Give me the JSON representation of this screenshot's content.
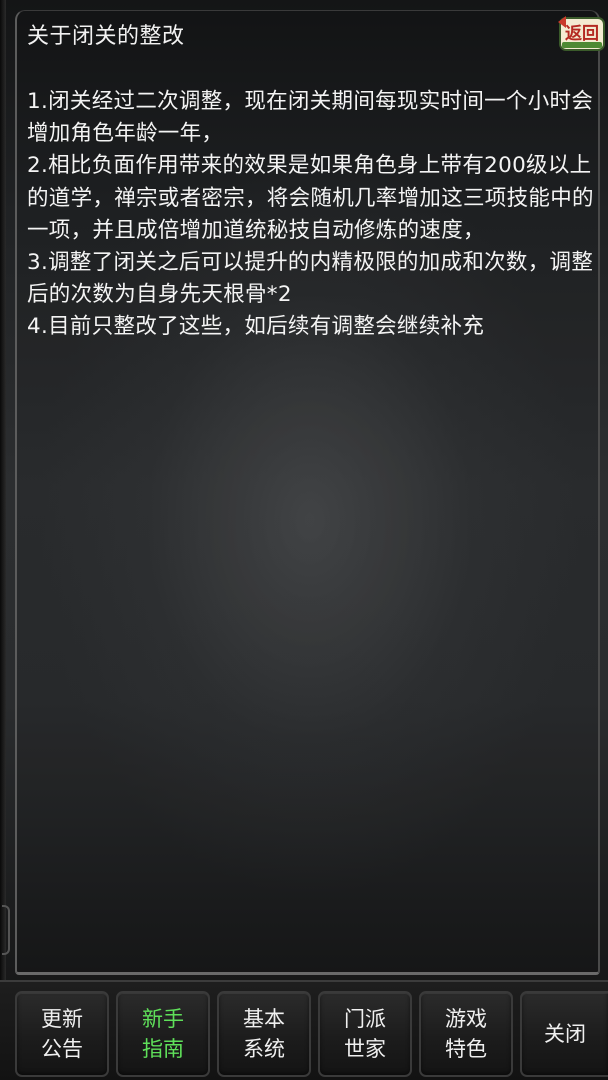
{
  "header": {
    "title": "关于闭关的整改",
    "back_icon": "return-badge-icon",
    "back_icon_text": "返回"
  },
  "notice": {
    "lines": [
      "1.闭关经过二次调整，现在闭关期间每现实时间一个小时会增加角色年龄一年，",
      "2.相比负面作用带来的效果是如果角色身上带有200级以上的道学，禅宗或者密宗，将会随机几率增加这三项技能中的一项，并且成倍增加道统秘技自动修炼的速度，",
      "3.调整了闭关之后可以提升的内精极限的加成和次数，调整后的次数为自身先天根骨*2",
      "4.目前只整改了这些，如后续有调整会继续补充"
    ]
  },
  "bottom_nav": {
    "items": [
      {
        "line1": "更新",
        "line2": "公告"
      },
      {
        "line1": "新手",
        "line2": "指南"
      },
      {
        "line1": "基本",
        "line2": "系统"
      },
      {
        "line1": "门派",
        "line2": "世家"
      },
      {
        "line1": "游戏",
        "line2": "特色"
      },
      {
        "line1": "关闭",
        "line2": ""
      }
    ],
    "active_index": 1,
    "active_color": "#5fe05a"
  }
}
